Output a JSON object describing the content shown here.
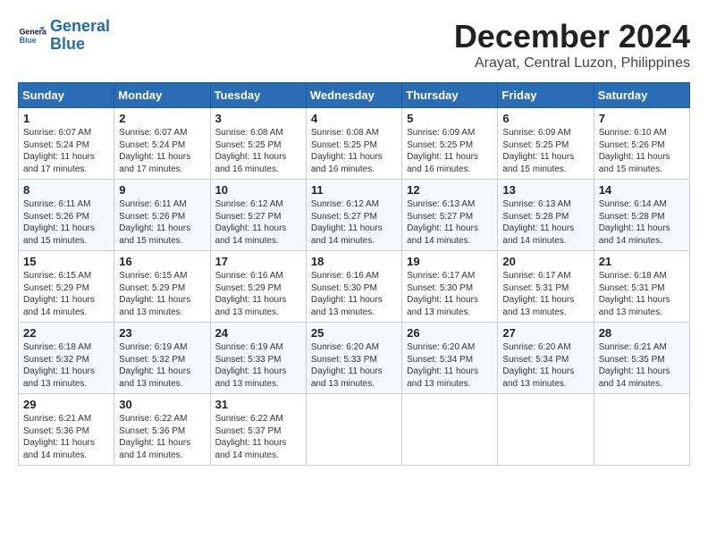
{
  "header": {
    "logo_line1": "General",
    "logo_line2": "Blue",
    "month_title": "December 2024",
    "location": "Arayat, Central Luzon, Philippines"
  },
  "calendar": {
    "days_of_week": [
      "Sunday",
      "Monday",
      "Tuesday",
      "Wednesday",
      "Thursday",
      "Friday",
      "Saturday"
    ],
    "weeks": [
      [
        {
          "day": "",
          "info": ""
        },
        {
          "day": "2",
          "info": "Sunrise: 6:07 AM\nSunset: 5:24 PM\nDaylight: 11 hours and 17 minutes."
        },
        {
          "day": "3",
          "info": "Sunrise: 6:08 AM\nSunset: 5:25 PM\nDaylight: 11 hours and 16 minutes."
        },
        {
          "day": "4",
          "info": "Sunrise: 6:08 AM\nSunset: 5:25 PM\nDaylight: 11 hours and 16 minutes."
        },
        {
          "day": "5",
          "info": "Sunrise: 6:09 AM\nSunset: 5:25 PM\nDaylight: 11 hours and 16 minutes."
        },
        {
          "day": "6",
          "info": "Sunrise: 6:09 AM\nSunset: 5:25 PM\nDaylight: 11 hours and 15 minutes."
        },
        {
          "day": "7",
          "info": "Sunrise: 6:10 AM\nSunset: 5:26 PM\nDaylight: 11 hours and 15 minutes."
        }
      ],
      [
        {
          "day": "8",
          "info": "Sunrise: 6:11 AM\nSunset: 5:26 PM\nDaylight: 11 hours and 15 minutes."
        },
        {
          "day": "9",
          "info": "Sunrise: 6:11 AM\nSunset: 5:26 PM\nDaylight: 11 hours and 15 minutes."
        },
        {
          "day": "10",
          "info": "Sunrise: 6:12 AM\nSunset: 5:27 PM\nDaylight: 11 hours and 14 minutes."
        },
        {
          "day": "11",
          "info": "Sunrise: 6:12 AM\nSunset: 5:27 PM\nDaylight: 11 hours and 14 minutes."
        },
        {
          "day": "12",
          "info": "Sunrise: 6:13 AM\nSunset: 5:27 PM\nDaylight: 11 hours and 14 minutes."
        },
        {
          "day": "13",
          "info": "Sunrise: 6:13 AM\nSunset: 5:28 PM\nDaylight: 11 hours and 14 minutes."
        },
        {
          "day": "14",
          "info": "Sunrise: 6:14 AM\nSunset: 5:28 PM\nDaylight: 11 hours and 14 minutes."
        }
      ],
      [
        {
          "day": "15",
          "info": "Sunrise: 6:15 AM\nSunset: 5:29 PM\nDaylight: 11 hours and 14 minutes."
        },
        {
          "day": "16",
          "info": "Sunrise: 6:15 AM\nSunset: 5:29 PM\nDaylight: 11 hours and 13 minutes."
        },
        {
          "day": "17",
          "info": "Sunrise: 6:16 AM\nSunset: 5:29 PM\nDaylight: 11 hours and 13 minutes."
        },
        {
          "day": "18",
          "info": "Sunrise: 6:16 AM\nSunset: 5:30 PM\nDaylight: 11 hours and 13 minutes."
        },
        {
          "day": "19",
          "info": "Sunrise: 6:17 AM\nSunset: 5:30 PM\nDaylight: 11 hours and 13 minutes."
        },
        {
          "day": "20",
          "info": "Sunrise: 6:17 AM\nSunset: 5:31 PM\nDaylight: 11 hours and 13 minutes."
        },
        {
          "day": "21",
          "info": "Sunrise: 6:18 AM\nSunset: 5:31 PM\nDaylight: 11 hours and 13 minutes."
        }
      ],
      [
        {
          "day": "22",
          "info": "Sunrise: 6:18 AM\nSunset: 5:32 PM\nDaylight: 11 hours and 13 minutes."
        },
        {
          "day": "23",
          "info": "Sunrise: 6:19 AM\nSunset: 5:32 PM\nDaylight: 11 hours and 13 minutes."
        },
        {
          "day": "24",
          "info": "Sunrise: 6:19 AM\nSunset: 5:33 PM\nDaylight: 11 hours and 13 minutes."
        },
        {
          "day": "25",
          "info": "Sunrise: 6:20 AM\nSunset: 5:33 PM\nDaylight: 11 hours and 13 minutes."
        },
        {
          "day": "26",
          "info": "Sunrise: 6:20 AM\nSunset: 5:34 PM\nDaylight: 11 hours and 13 minutes."
        },
        {
          "day": "27",
          "info": "Sunrise: 6:20 AM\nSunset: 5:34 PM\nDaylight: 11 hours and 13 minutes."
        },
        {
          "day": "28",
          "info": "Sunrise: 6:21 AM\nSunset: 5:35 PM\nDaylight: 11 hours and 14 minutes."
        }
      ],
      [
        {
          "day": "29",
          "info": "Sunrise: 6:21 AM\nSunset: 5:36 PM\nDaylight: 11 hours and 14 minutes."
        },
        {
          "day": "30",
          "info": "Sunrise: 6:22 AM\nSunset: 5:36 PM\nDaylight: 11 hours and 14 minutes."
        },
        {
          "day": "31",
          "info": "Sunrise: 6:22 AM\nSunset: 5:37 PM\nDaylight: 11 hours and 14 minutes."
        },
        {
          "day": "",
          "info": ""
        },
        {
          "day": "",
          "info": ""
        },
        {
          "day": "",
          "info": ""
        },
        {
          "day": "",
          "info": ""
        }
      ]
    ],
    "first_week_sunday": {
      "day": "1",
      "info": "Sunrise: 6:07 AM\nSunset: 5:24 PM\nDaylight: 11 hours and 17 minutes."
    }
  }
}
